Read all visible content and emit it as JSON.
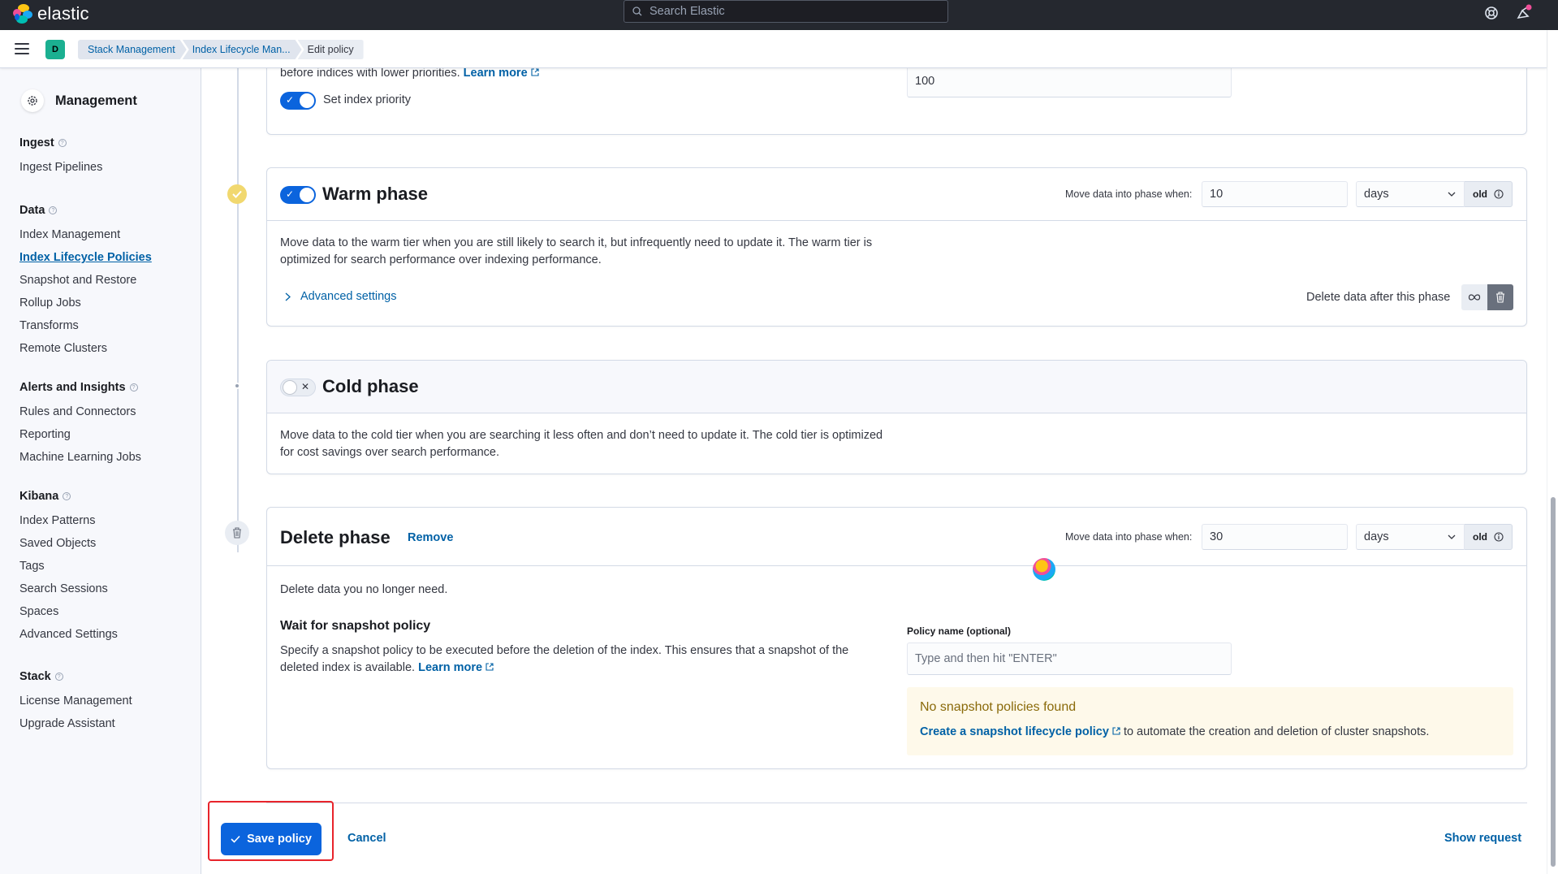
{
  "header": {
    "brand": "elastic",
    "search_placeholder": "Search Elastic"
  },
  "breadcrumbs": {
    "space_initial": "D",
    "items": [
      "Stack Management",
      "Index Lifecycle Man...",
      "Edit policy"
    ]
  },
  "sidebar": {
    "title": "Management",
    "groups": [
      {
        "heading": "Ingest",
        "items": [
          "Ingest Pipelines"
        ]
      },
      {
        "heading": "Data",
        "items": [
          "Index Management",
          "Index Lifecycle Policies",
          "Snapshot and Restore",
          "Rollup Jobs",
          "Transforms",
          "Remote Clusters"
        ]
      },
      {
        "heading": "Alerts and Insights",
        "items": [
          "Rules and Connectors",
          "Reporting",
          "Machine Learning Jobs"
        ]
      },
      {
        "heading": "Kibana",
        "items": [
          "Index Patterns",
          "Saved Objects",
          "Tags",
          "Search Sessions",
          "Spaces",
          "Advanced Settings"
        ]
      },
      {
        "heading": "Stack",
        "items": [
          "License Management",
          "Upgrade Assistant"
        ]
      }
    ],
    "active_item": "Index Lifecycle Policies"
  },
  "hot_phase_tail": {
    "desc_tail": "before indices with lower priorities.",
    "learn_more": "Learn more",
    "priority_toggle_label": "Set index priority",
    "priority_value": "100"
  },
  "warm_phase": {
    "title": "Warm phase",
    "move_label": "Move data into phase when:",
    "age_value": "10",
    "unit": "days",
    "suffix": "old",
    "description": "Move data to the warm tier when you are still likely to search it, but infrequently need to update it. The warm tier is optimized for search performance over indexing performance.",
    "advanced_settings": "Advanced settings",
    "delete_after_label": "Delete data after this phase"
  },
  "cold_phase": {
    "title": "Cold phase",
    "description": "Move data to the cold tier when you are searching it less often and don’t need to update it. The cold tier is optimized for cost savings over search performance."
  },
  "delete_phase": {
    "title": "Delete phase",
    "remove": "Remove",
    "move_label": "Move data into phase when:",
    "age_value": "30",
    "unit": "days",
    "suffix": "old",
    "description": "Delete data you no longer need.",
    "snapshot_heading": "Wait for snapshot policy",
    "snapshot_desc": "Specify a snapshot policy to be executed before the deletion of the index. This ensures that a snapshot of the deleted index is available.",
    "learn_more": "Learn more",
    "policy_name_label": "Policy name (optional)",
    "policy_name_placeholder": "Type and then hit \"ENTER\"",
    "callout_title": "No snapshot policies found",
    "callout_link": "Create a snapshot lifecycle policy",
    "callout_text": "to automate the creation and deletion of cluster snapshots."
  },
  "footer": {
    "save": "Save policy",
    "cancel": "Cancel",
    "show_request": "Show request"
  },
  "colors": {
    "primary": "#0b64dd",
    "link": "#0061a6",
    "warm_dot": "#f1d86f",
    "callout_bg": "#fef9ea",
    "callout_title": "#8a6a0a",
    "highlight": "#e8242b"
  }
}
